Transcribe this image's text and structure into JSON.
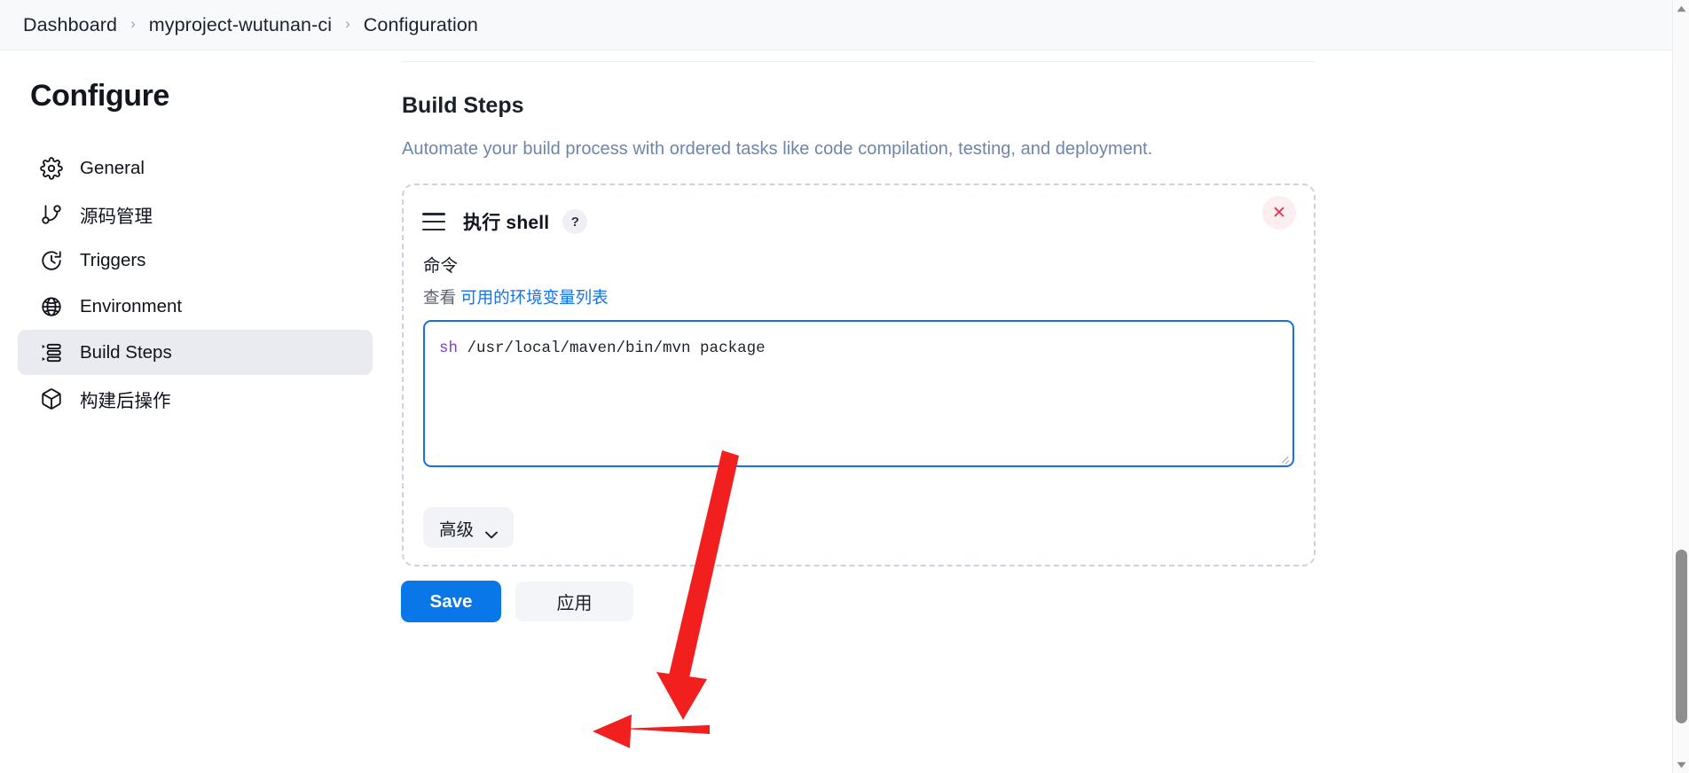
{
  "breadcrumb": {
    "items": [
      {
        "label": "Dashboard"
      },
      {
        "label": "myproject-wutunan-ci"
      },
      {
        "label": "Configuration"
      }
    ],
    "separator": "›"
  },
  "sidebar": {
    "title": "Configure",
    "items": [
      {
        "label": "General",
        "icon": "gear-icon",
        "active": false
      },
      {
        "label": "源码管理",
        "icon": "git-branch-icon",
        "active": false
      },
      {
        "label": "Triggers",
        "icon": "clock-icon",
        "active": false
      },
      {
        "label": "Environment",
        "icon": "globe-icon",
        "active": false
      },
      {
        "label": "Build Steps",
        "icon": "list-steps-icon",
        "active": true
      },
      {
        "label": "构建后操作",
        "icon": "package-icon",
        "active": false
      }
    ]
  },
  "main": {
    "section_title": "Build Steps",
    "section_desc": "Automate your build process with ordered tasks like code compilation, testing, and deployment.",
    "step": {
      "title": "执行 shell",
      "help_label": "?",
      "close_label": "✕",
      "field_label": "命令",
      "env_prefix": "查看",
      "env_link": "可用的环境变量列表",
      "command_keyword": "sh",
      "command_rest": " /usr/local/maven/bin/mvn package",
      "advanced_label": "高级"
    }
  },
  "actions": {
    "save_label": "Save",
    "apply_label": "应用"
  },
  "colors": {
    "accent_blue": "#0a77e8",
    "link_blue": "#1473e6",
    "desc_blue_gray": "#6e85ab",
    "close_red": "#e8334a",
    "annotation_red": "#f21f1f",
    "sidebar_active_bg": "#e9ebf0",
    "keyword_purple": "#7a3fd4"
  }
}
